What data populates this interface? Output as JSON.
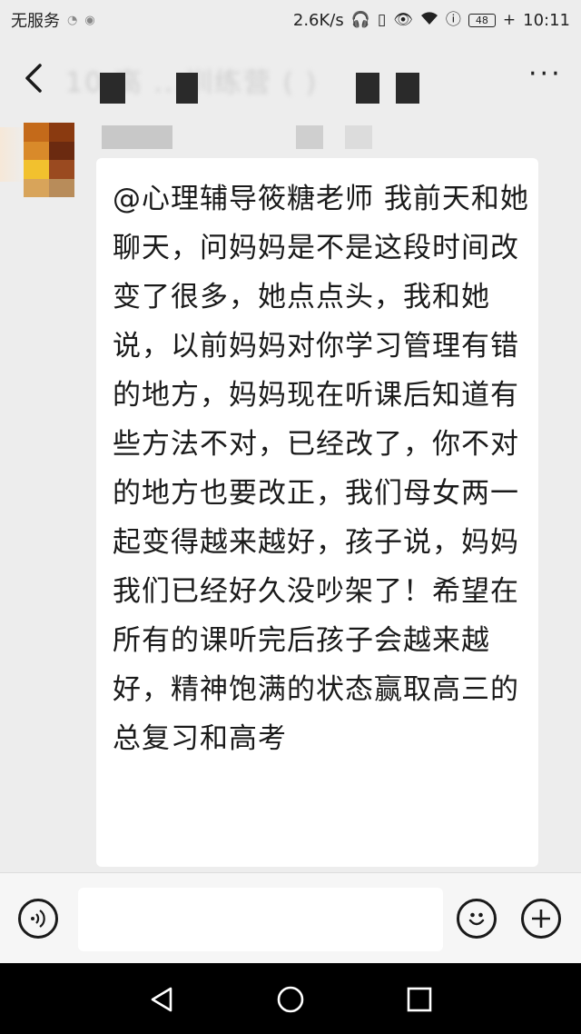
{
  "status_bar": {
    "carrier": "无服务",
    "speed": "2.6K/s",
    "battery": "48",
    "time": "10:11"
  },
  "header": {
    "title": "10 高 ...训练营 ( )"
  },
  "message": {
    "text": "@心理辅导筱糖老师  我前天和她聊天，问妈妈是不是这段时间改变了很多，她点点头，我和她说，以前妈妈对你学习管理有错的地方，妈妈现在听课后知道有些方法不对，已经改了，你不对的地方也要改正，我们母女两一起变得越来越好，孩子说，妈妈我们已经好久没吵架了！希望在所有的课听完后孩子会越来越好，精神饱满的状态赢取高三的总复习和高考"
  },
  "input": {
    "placeholder": ""
  },
  "colors": {
    "background": "#ededed",
    "bubble": "#ffffff",
    "nav": "#000000"
  },
  "icons": [
    "back-arrow-icon",
    "more-icon",
    "voice-icon",
    "emoji-icon",
    "plus-icon",
    "nav-back-icon",
    "nav-home-icon",
    "nav-recent-icon"
  ]
}
